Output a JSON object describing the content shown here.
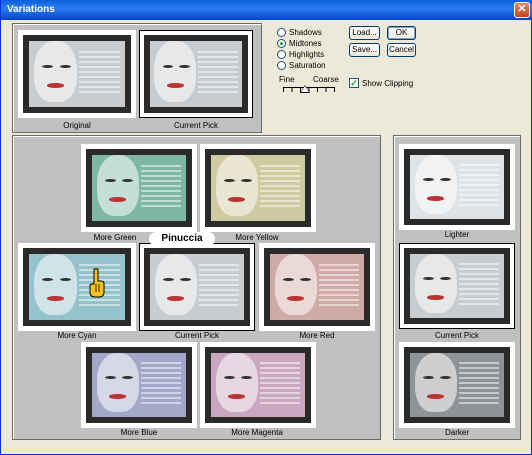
{
  "window": {
    "title": "Variations",
    "close_glyph": "✕"
  },
  "top_panel": {
    "original_label": "Original",
    "current_pick_label": "Current Pick"
  },
  "tone": {
    "options": [
      "Shadows",
      "Midtones",
      "Highlights",
      "Saturation"
    ],
    "selected": "Midtones"
  },
  "buttons": {
    "load": "Load...",
    "ok": "OK",
    "save": "Save...",
    "cancel": "Cancel"
  },
  "slider": {
    "fine_label": "Fine",
    "coarse_label": "Coarse",
    "position_fraction": 0.42
  },
  "show_clipping": {
    "label": "Show Clipping",
    "checked": true,
    "mark": "✓"
  },
  "color_grid": {
    "more_green": "More Green",
    "more_yellow": "More Yellow",
    "more_cyan": "More Cyan",
    "current_pick": "Current Pick",
    "more_red": "More Red",
    "more_blue": "More Blue",
    "more_magenta": "More Magenta"
  },
  "brightness": {
    "lighter": "Lighter",
    "current_pick": "Current Pick",
    "darker": "Darker"
  },
  "watermark": {
    "text": "Pinuccia"
  },
  "tints": {
    "original": "#c9cccf",
    "current": "#c9cccf",
    "green": "#7fb7a7",
    "yellow": "#cfcaa0",
    "cyan": "#95c3cc",
    "red": "#d0aaa6",
    "blue": "#a3a8c9",
    "magenta": "#c9a7c1",
    "lighter": "#dfe3e5",
    "darker": "#8f9396"
  }
}
